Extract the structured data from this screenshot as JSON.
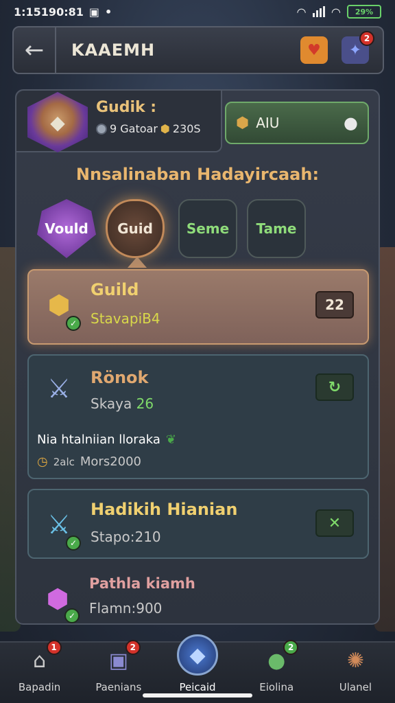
{
  "status": {
    "time": "1:15190:81",
    "battery_label": "29%"
  },
  "header": {
    "title": "KAAEMH",
    "heart_badge": "",
    "puzzle_badge": "2"
  },
  "profile": {
    "name": "Gudik :",
    "coins": "9 Gatoar",
    "gold": "230S",
    "add_label": "AIU"
  },
  "section": {
    "title": "Nnsalinaban Hadayircaah:"
  },
  "tabs": [
    {
      "label": "Vould"
    },
    {
      "label": "Guid"
    },
    {
      "label": "Seme"
    },
    {
      "label": "Tame"
    }
  ],
  "cards": {
    "guild": {
      "title": "Guild",
      "subtitle": "Stavapi",
      "subtitle_hl": "B4",
      "value": "22"
    },
    "ronok": {
      "title": "Rönok",
      "subtitle": "Skaya",
      "subtitle_hl": "26",
      "desc": "Nia htalniian lloraka",
      "meta_prefix": "2alc",
      "meta": "Mors2000"
    },
    "hadik": {
      "title": "Hadikih Hianian",
      "subtitle": "Stapo:210"
    },
    "plain": {
      "title": "Pathla kiamh",
      "subtitle": "Flamn:900"
    }
  },
  "nav": [
    {
      "label": "Bapadin",
      "badge": "1"
    },
    {
      "label": "Paenians",
      "badge": "2"
    },
    {
      "label": "Peicaid",
      "badge": ""
    },
    {
      "label": "Eiolina",
      "badge": "2"
    },
    {
      "label": "Ulanel",
      "badge": ""
    }
  ],
  "colors": {
    "accent_gold": "#f0d070",
    "accent_green": "#7fda6a",
    "badge_red": "#d4322a"
  }
}
